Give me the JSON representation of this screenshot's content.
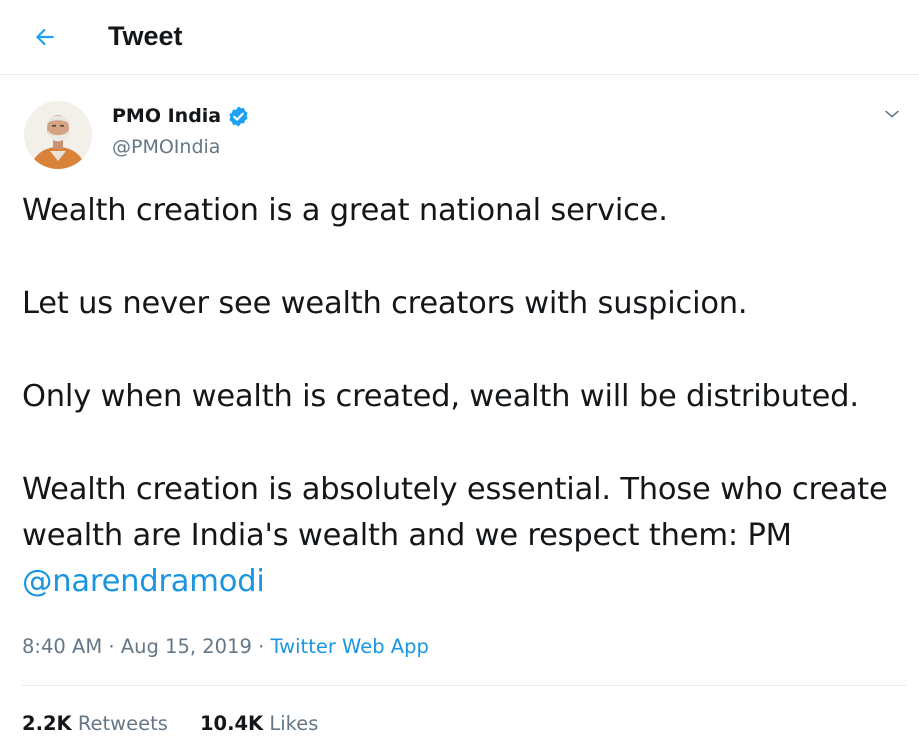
{
  "colors": {
    "accent": "#1da1f2",
    "link": "#1b95e0",
    "text": "#14171a",
    "secondary": "#657786",
    "divider": "#e6ecf0"
  },
  "header": {
    "back_icon": "arrow-left-icon",
    "title": "Tweet"
  },
  "author": {
    "avatar_icon": "profile-photo",
    "name": "PMO India",
    "verified_icon": "verified-badge-icon",
    "handle": "@PMOIndia",
    "menu_icon": "chevron-down-icon"
  },
  "tweet": {
    "paragraph_1": "Wealth creation is a great national service.",
    "paragraph_2": "Let us never see wealth creators with suspicion.",
    "paragraph_3": "Only when wealth is created, wealth will be distributed.",
    "paragraph_4_text": "Wealth creation is absolutely essential. Those who create wealth are India's wealth and we respect them: PM ",
    "paragraph_4_mention": "@narendramodi"
  },
  "meta": {
    "time": "8:40 AM",
    "separator_1": " · ",
    "date": "Aug 15, 2019",
    "separator_2": " · ",
    "source": "Twitter Web App"
  },
  "stats": {
    "retweets_count": "2.2K",
    "retweets_label": "Retweets",
    "likes_count": "10.4K",
    "likes_label": "Likes"
  }
}
